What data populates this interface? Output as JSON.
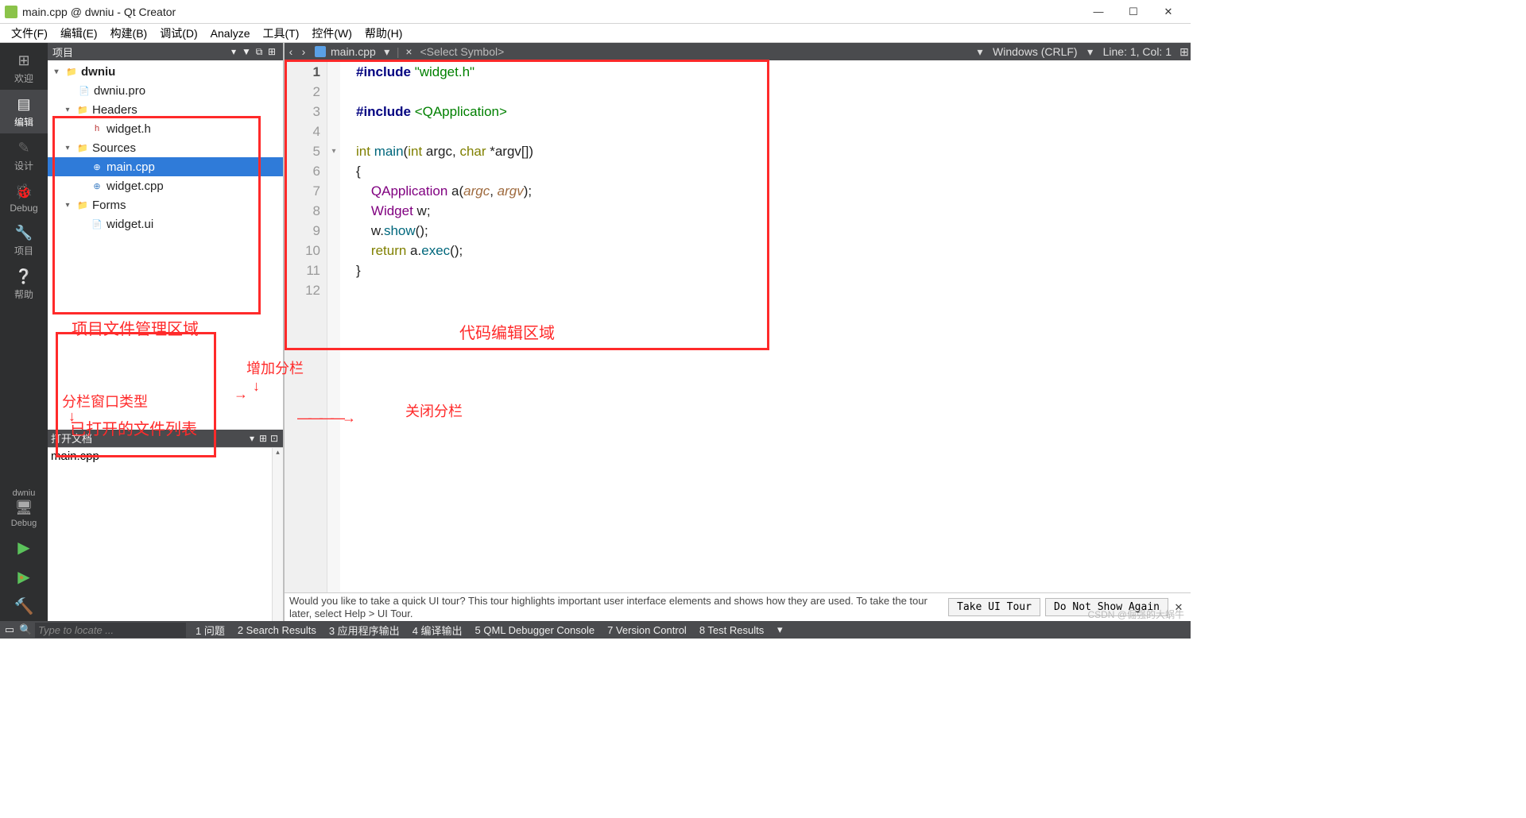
{
  "window": {
    "title": "main.cpp @ dwniu - Qt Creator"
  },
  "menus": {
    "file": "文件(F)",
    "edit": "编辑(E)",
    "build": "构建(B)",
    "debug": "调试(D)",
    "analyze": "Analyze",
    "tools": "工具(T)",
    "widgets": "控件(W)",
    "help": "帮助(H)"
  },
  "sidebar": {
    "welcome": "欢迎",
    "edit": "编辑",
    "design": "设计",
    "debug": "Debug",
    "projects": "项目",
    "help": "帮助",
    "target": "dwniu",
    "target_mode": "Debug"
  },
  "project_panel": {
    "title": "项目",
    "root": "dwniu",
    "pro": "dwniu.pro",
    "headers": "Headers",
    "widget_h": "widget.h",
    "sources": "Sources",
    "main_cpp": "main.cpp",
    "widget_cpp": "widget.cpp",
    "forms": "Forms",
    "widget_ui": "widget.ui"
  },
  "open_docs": {
    "title": "打开文档",
    "items": [
      "main.cpp"
    ]
  },
  "editor": {
    "file": "main.cpp",
    "symbol_placeholder": "<Select Symbol>",
    "line_ending": "Windows (CRLF)",
    "cursor": "Line: 1, Col: 1",
    "lines": [
      "1",
      "2",
      "3",
      "4",
      "5",
      "6",
      "7",
      "8",
      "9",
      "10",
      "11",
      "12"
    ],
    "code_tokens": {
      "l1_pp": "#include ",
      "l1_str": "\"widget.h\"",
      "l3_pp": "#include ",
      "l3_inc": "<QApplication>",
      "l5_kw1": "int ",
      "l5_fn": "main",
      "l5_p1": "(",
      "l5_kw2": "int ",
      "l5_a1": "argc",
      "l5_c": ", ",
      "l5_kw3": "char ",
      "l5_a2": "*argv[]",
      "l5_p2": ")",
      "l6": "{",
      "l7_cls": "QApplication",
      "l7_rest": " a(",
      "l7_a1": "argc",
      "l7_c": ", ",
      "l7_a2": "argv",
      "l7_end": ");",
      "l8_cls": "Widget",
      "l8_rest": " w;",
      "l9_pre": "    w.",
      "l9_fn": "show",
      "l9_end": "();",
      "l10_kw": "return ",
      "l10_pre": "a.",
      "l10_fn": "exec",
      "l10_end": "();",
      "l11": "}"
    }
  },
  "tour": {
    "text": "Would you like to take a quick UI tour? This tour highlights important user interface elements and shows how they are used. To take the tour later, select Help > UI Tour.",
    "take": "Take UI Tour",
    "dismiss": "Do Not Show Again"
  },
  "status": {
    "search_placeholder": "Type to locate ...",
    "panes": {
      "p1": "1 问题",
      "p2": "2 Search Results",
      "p3": "3 应用程序输出",
      "p4": "4 编译输出",
      "p5": "5 QML Debugger Console",
      "p7": "7 Version Control",
      "p8": "8 Test Results"
    }
  },
  "annotations": {
    "proj": "项目文件管理区域",
    "code": "代码编辑区域",
    "split_type": "分栏窗口类型",
    "add_split": "增加分栏",
    "close_split": "关闭分栏",
    "open_list": "已打开的文件列表"
  },
  "watermark": "CSDN @倔强的大蜗牛"
}
